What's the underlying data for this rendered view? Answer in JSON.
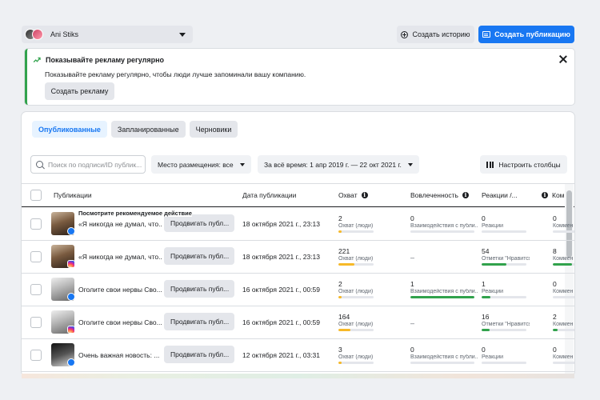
{
  "header": {
    "account_name": "Ani Stiks",
    "create_story_label": "Создать историю",
    "create_post_label": "Создать публикацию"
  },
  "banner": {
    "title": "Показывайте рекламу регулярно",
    "text": "Показывайте рекламу регулярно, чтобы люди лучше запоминали вашу компанию.",
    "button_label": "Создать рекламу"
  },
  "tabs": [
    {
      "label": "Опубликованные",
      "active": true
    },
    {
      "label": "Запланированные",
      "active": false
    },
    {
      "label": "Черновики",
      "active": false
    }
  ],
  "filters": {
    "search_placeholder": "Поиск по подписи/ID публик...",
    "placement": "Место размещения: все",
    "date_range": "За всё время: 1 апр 2019 г. — 22 окт 2021 г.",
    "columns_button": "Настроить столбцы"
  },
  "columns": {
    "posts": "Публикации",
    "date": "Дата публикации",
    "reach": "Охват",
    "engagement": "Вовлеченность",
    "reactions": "Реакции /...",
    "comments": "Ком"
  },
  "tooltip": "Посмотрите рекомендуемое действие",
  "promote_label": "Продвигать публ...",
  "rows": [
    {
      "platform": "fb",
      "thumb": "t1",
      "text": "«Я никогда не думал, что...",
      "date": "18 октября 2021 г., 23:13",
      "reach": "2",
      "reach_label": "Охват (люди)",
      "reach_fill": 0.02,
      "engagement": "0",
      "engagement_label": "Взаимодействия с публи...",
      "engagement_fill": 0,
      "reactions": "0",
      "reactions_label": "Реакции",
      "reactions_fill": 0,
      "comments": "0",
      "comments_label": "Коммен",
      "comments_fill": 0
    },
    {
      "platform": "ig",
      "thumb": "t1",
      "text": "«Я никогда не думал, что...",
      "date": "18 октября 2021 г., 23:13",
      "reach": "221",
      "reach_label": "Охват (люди)",
      "reach_fill": 0.45,
      "engagement": "–",
      "engagement_label": "",
      "engagement_fill": null,
      "reactions": "54",
      "reactions_label": "Отметки \"Нравится\"",
      "reactions_fill": 0.55,
      "comments": "8",
      "comments_label": "Коммен",
      "comments_fill": 0.8
    },
    {
      "platform": "fb",
      "thumb": "t2",
      "text": "Оголите свои нервы Сво...",
      "date": "16 октября 2021 г., 00:59",
      "reach": "2",
      "reach_label": "Охват (люди)",
      "reach_fill": 0.02,
      "engagement": "1",
      "engagement_label": "Взаимодействия с публи...",
      "engagement_fill": 1,
      "reactions": "1",
      "reactions_label": "Реакции",
      "reactions_fill": 0.2,
      "comments": "0",
      "comments_label": "Коммен",
      "comments_fill": 0
    },
    {
      "platform": "ig",
      "thumb": "t2",
      "text": "Оголите свои нервы Сво...",
      "date": "16 октября 2021 г., 00:59",
      "reach": "164",
      "reach_label": "Охват (люди)",
      "reach_fill": 0.33,
      "engagement": "–",
      "engagement_label": "",
      "engagement_fill": null,
      "reactions": "16",
      "reactions_label": "Отметки \"Нравится\"",
      "reactions_fill": 0.18,
      "comments": "2",
      "comments_label": "Коммен",
      "comments_fill": 0.2
    },
    {
      "platform": "fb",
      "thumb": "t3",
      "text": "Очень важная новость: ...",
      "date": "12 октября 2021 г., 03:31",
      "reach": "3",
      "reach_label": "Охват (люди)",
      "reach_fill": 0.02,
      "engagement": "0",
      "engagement_label": "Взаимодействия с публи...",
      "engagement_fill": 0,
      "reactions": "0",
      "reactions_label": "Реакции",
      "reactions_fill": 0,
      "comments": "0",
      "comments_label": "Коммен",
      "comments_fill": 0
    }
  ],
  "colors": {
    "accent": "#1877f2",
    "reach_bar": "#f7b928",
    "engagement_bar": "#31a24c",
    "reactions_bar": "#31a24c",
    "banner_border": "#31a24c"
  }
}
